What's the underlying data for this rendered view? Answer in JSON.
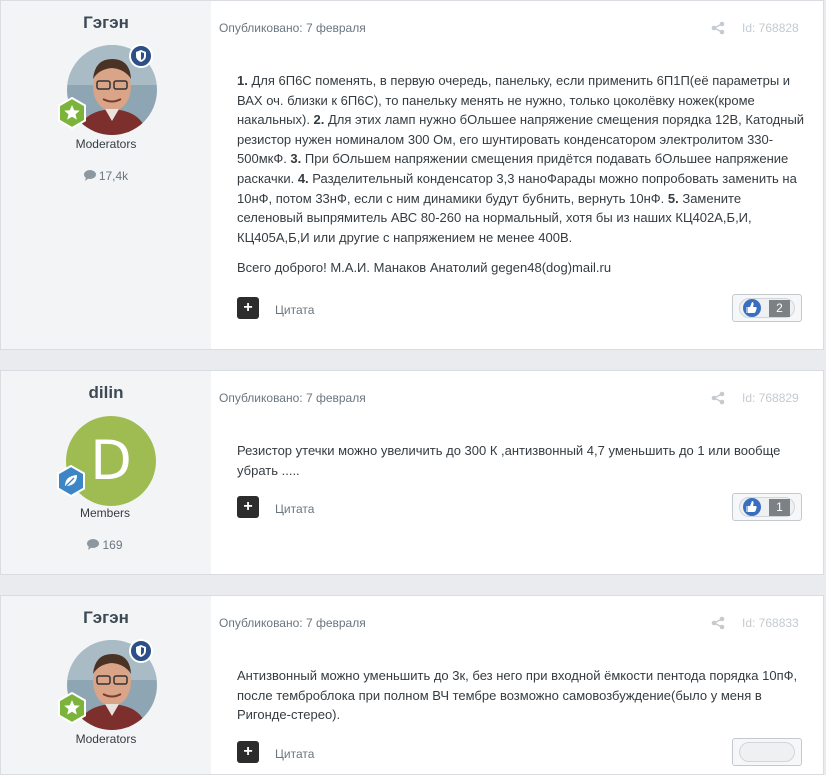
{
  "posts": [
    {
      "author": "Гэгэн",
      "group": "Moderators",
      "post_count": "17,4k",
      "published": "Опубликовано: 7 февраля",
      "post_id": "Id: 768828",
      "paragraphs": [
        [
          {
            "b": true,
            "t": "1."
          },
          {
            "t": " Для 6П6С поменять, в первую очередь,  панельку, если применить 6П1П(её параметры и ВАХ оч. близки к 6П6С), то панельку менять не нужно, только цоколёвку ножек(кроме накальных).  "
          },
          {
            "b": true,
            "t": "2."
          },
          {
            "t": " Для этих ламп нужно бОльшее напряжение  смещения порядка 12В, Катодный резистор нужен номиналом 300 Ом, его шунтировать конденсатором электролитом 330-500мкФ.  "
          },
          {
            "b": true,
            "t": "3."
          },
          {
            "t": " При бОльшем напряжении смещения придётся подавать бОльшее напряжение раскачки.  "
          },
          {
            "b": true,
            "t": "4."
          },
          {
            "t": " Разделительный конденсатор 3,3 наноФарады можно попробовать заменить на 10нФ, потом 33нФ, если с ним динамики будут бубнить, вернуть 10нФ. "
          },
          {
            "b": true,
            "t": "5."
          },
          {
            "t": " Замените селеновый выпрямитель АВС 80-260 на  нормальный, хотя бы из наших КЦ402А,Б,И,   КЦ405А,Б,И или другие с напряжением не менее 400В."
          }
        ],
        [
          {
            "t": "Всего доброго!   М.А.И.  Манаков Анатолий   gegen48(dog)mail.ru"
          }
        ]
      ],
      "quote_label": "Цитата",
      "likes": "2"
    },
    {
      "author": "dilin",
      "avatar_letter": "D",
      "group": "Members",
      "post_count": "169",
      "published": "Опубликовано: 7 февраля",
      "post_id": "Id: 768829",
      "paragraphs": [
        [
          {
            "t": "Резистор утечки можно увеличить до 300 К ,антизвонный 4,7 уменьшить до 1 или вообще убрать ....."
          }
        ]
      ],
      "quote_label": "Цитата",
      "likes": "1"
    },
    {
      "author": "Гэгэн",
      "group": "Moderators",
      "published": "Опубликовано: 7 февраля",
      "post_id": "Id: 768833",
      "paragraphs": [
        [
          {
            "t": "Антизвонный можно уменьшить до 3к, без него при входной ёмкости пентода порядка 10пФ, после темброблока  при полном ВЧ тембре возможно самовозбуждение(было у меня в Ригонде-стерео)."
          }
        ]
      ],
      "quote_label": "Цитата"
    }
  ],
  "colors": {
    "moderator_badge": "#2b4f86",
    "rank_star_badge": "#7bb33b",
    "rank_leaf_badge": "#3d86c6",
    "letter_avatar": "#9fbc52",
    "like_thumb": "#3a6fc0"
  },
  "icons": [
    "shield-icon",
    "star-badge-icon",
    "leaf-badge-icon",
    "comment-bubble-icon",
    "share-icon",
    "plus-icon",
    "thumbs-up-icon"
  ]
}
